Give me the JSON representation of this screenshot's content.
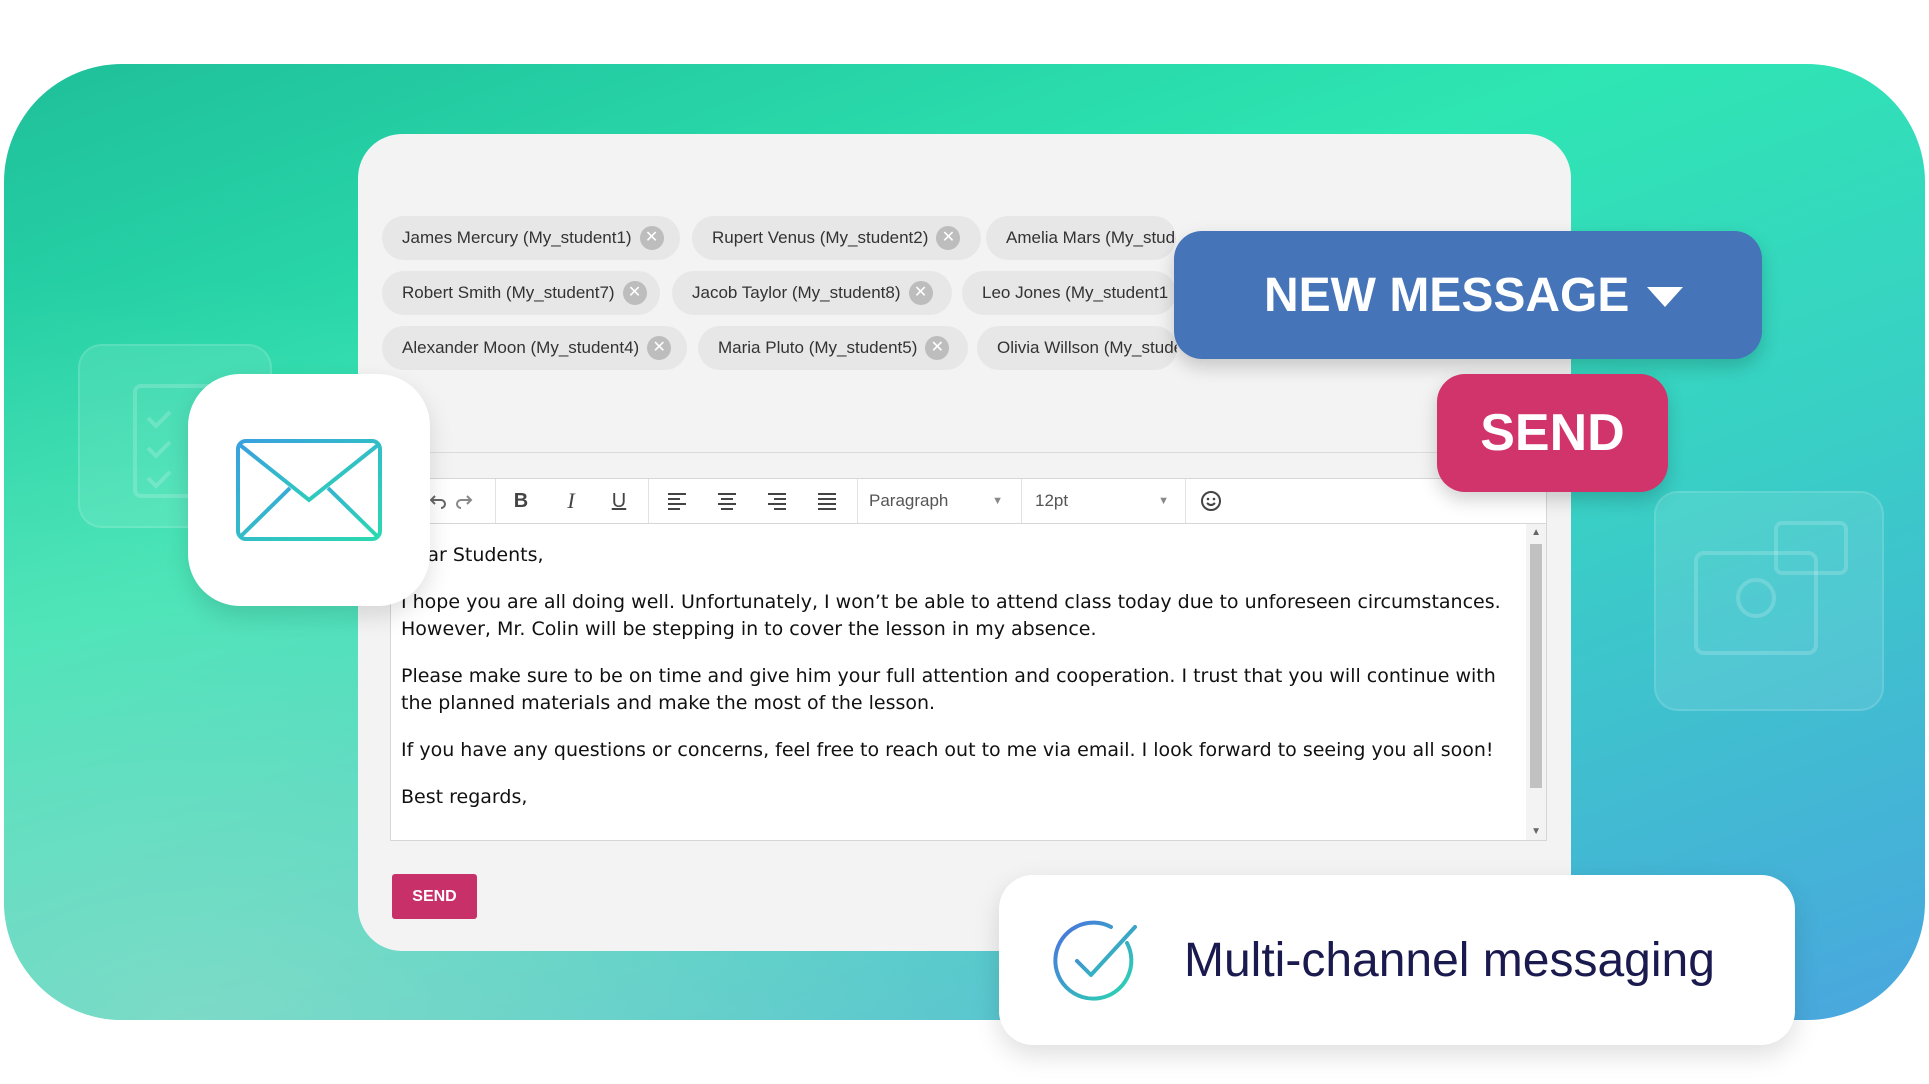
{
  "recipients": [
    {
      "name": "James Mercury (My_student1)"
    },
    {
      "name": "Rupert Venus (My_student2)"
    },
    {
      "name": "Amelia Mars (My_student3)"
    },
    {
      "name": "Robert Smith (My_student7)"
    },
    {
      "name": "Jacob Taylor (My_student8)"
    },
    {
      "name": "Leo Jones (My_student1"
    },
    {
      "name": "Alexander Moon (My_student4)"
    },
    {
      "name": "Maria Pluto (My_student5)"
    },
    {
      "name": "Olivia Willson (My_student6)"
    }
  ],
  "chip_remove_icon": "close-circle-icon",
  "toolbar": {
    "paragraph_select": "Paragraph",
    "size_select": "12pt",
    "bold": "B",
    "italic": "I",
    "underline": "U"
  },
  "editor": {
    "greeting": "Dear Students,",
    "paragraphs": [
      "I hope you are all doing well. Unfortunately, I won’t be able to attend class today due to unforeseen circumstances. However, Mr. Colin will be stepping in to cover the lesson in my absence.",
      "Please make sure to be on time and give him your full attention and cooperation. I trust that you will continue with the planned materials and make the most of the lesson.",
      "If you have any questions or concerns, feel free to reach out to me via email. I look forward to seeing you all soon!"
    ],
    "closing": "Best regards,"
  },
  "send_small_label": "SEND",
  "new_message_label": "NEW MESSAGE",
  "send_big_label": "SEND",
  "feature_label": "Multi-channel messaging",
  "colors": {
    "new_message_bg": "#4574b8",
    "send_bg": "#d1336b",
    "small_send_bg": "#c8306a",
    "feature_text": "#1a1a4e"
  }
}
